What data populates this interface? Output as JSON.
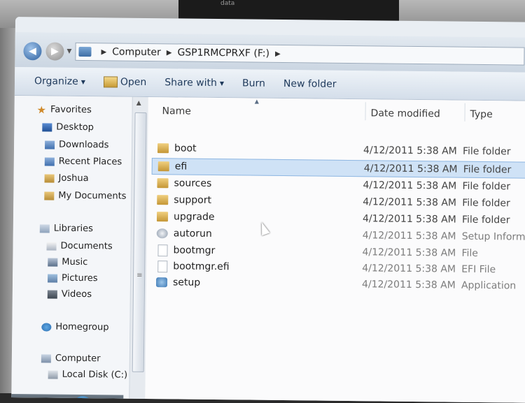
{
  "background": {
    "top_text": "data"
  },
  "address_bar": {
    "crumbs": [
      "Computer",
      "GSP1RMCPRXF (F:)"
    ]
  },
  "toolbar": {
    "organize": "Organize",
    "open": "Open",
    "share_with": "Share with",
    "burn": "Burn",
    "new_folder": "New folder"
  },
  "nav": {
    "favorites": "Favorites",
    "desktop": "Desktop",
    "downloads": "Downloads",
    "recent_places": "Recent Places",
    "joshua": "Joshua",
    "my_documents": "My Documents",
    "libraries": "Libraries",
    "documents": "Documents",
    "music": "Music",
    "pictures": "Pictures",
    "videos": "Videos",
    "homegroup": "Homegroup",
    "computer": "Computer",
    "local_disk": "Local Disk (C:)"
  },
  "columns": {
    "name": "Name",
    "date_modified": "Date modified",
    "type": "Type"
  },
  "files": [
    {
      "name": "boot",
      "date": "4/12/2011 5:38 AM",
      "type": "File folder",
      "icon": "folder-icon"
    },
    {
      "name": "efi",
      "date": "4/12/2011 5:38 AM",
      "type": "File folder",
      "icon": "folder-icon"
    },
    {
      "name": "sources",
      "date": "4/12/2011 5:38 AM",
      "type": "File folder",
      "icon": "folder-icon"
    },
    {
      "name": "support",
      "date": "4/12/2011 5:38 AM",
      "type": "File folder",
      "icon": "folder-icon"
    },
    {
      "name": "upgrade",
      "date": "4/12/2011 5:38 AM",
      "type": "File folder",
      "icon": "folder-icon"
    },
    {
      "name": "autorun",
      "date": "4/12/2011 5:38 AM",
      "type": "Setup Informa",
      "icon": "setup-info-icon"
    },
    {
      "name": "bootmgr",
      "date": "4/12/2011 5:38 AM",
      "type": "File",
      "icon": "file-icon"
    },
    {
      "name": "bootmgr.efi",
      "date": "4/12/2011 5:38 AM",
      "type": "EFI File",
      "icon": "file-icon"
    },
    {
      "name": "setup",
      "date": "4/12/2011 5:38 AM",
      "type": "Application",
      "icon": "setup-app-icon"
    }
  ],
  "selected_file": "efi"
}
